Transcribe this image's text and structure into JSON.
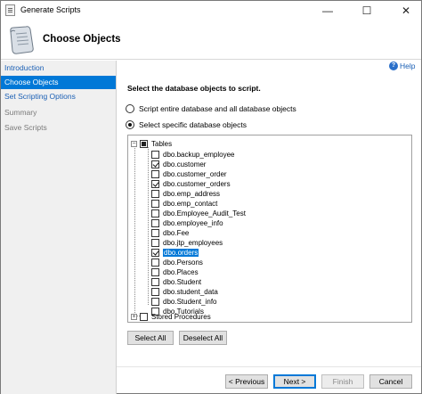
{
  "window": {
    "title": "Generate Scripts",
    "minimize_glyph": "—",
    "maximize_glyph": "☐",
    "close_glyph": "✕"
  },
  "header": {
    "title": "Choose Objects",
    "icon": "scroll-icon"
  },
  "nav": {
    "items": [
      {
        "label": "Introduction",
        "state": "link"
      },
      {
        "label": "Choose Objects",
        "state": "selected"
      },
      {
        "label": "Set Scripting Options",
        "state": "link"
      },
      {
        "label": "Summary",
        "state": "disabled"
      },
      {
        "label": "Save Scripts",
        "state": "disabled"
      }
    ]
  },
  "help": {
    "label": "Help",
    "icon": "help-icon"
  },
  "main": {
    "instruction": "Select the database objects to script.",
    "radio_entire": "Script entire database and all database objects",
    "radio_specific": "Select specific database objects",
    "selected_option": "specific"
  },
  "tree": {
    "tables_label": "Tables",
    "tables_state": "indeterminate",
    "tables_expander": "−",
    "items": [
      {
        "label": "dbo.backup_employee",
        "checked": false
      },
      {
        "label": "dbo.customer",
        "checked": true
      },
      {
        "label": "dbo.customer_order",
        "checked": false
      },
      {
        "label": "dbo.customer_orders",
        "checked": true
      },
      {
        "label": "dbo.emp_address",
        "checked": false
      },
      {
        "label": "dbo.emp_contact",
        "checked": false
      },
      {
        "label": "dbo.Employee_Audit_Test",
        "checked": false
      },
      {
        "label": "dbo.employee_info",
        "checked": false
      },
      {
        "label": "dbo.Fee",
        "checked": false
      },
      {
        "label": "dbo.jtp_employees",
        "checked": false
      },
      {
        "label": "dbo.orders",
        "checked": true,
        "highlighted": true
      },
      {
        "label": "dbo.Persons",
        "checked": false
      },
      {
        "label": "dbo.Places",
        "checked": false
      },
      {
        "label": "dbo.Student",
        "checked": false
      },
      {
        "label": "dbo.student_data",
        "checked": false
      },
      {
        "label": "dbo.Student_info",
        "checked": false
      },
      {
        "label": "dbo.Tutorials",
        "checked": false
      }
    ],
    "stored_procedures_label": "Stored Procedures",
    "stored_procedures_expander": "+"
  },
  "buttons": {
    "select_all": "Select All",
    "deselect_all": "Deselect All",
    "previous": "< Previous",
    "next": "Next >",
    "finish": "Finish",
    "cancel": "Cancel"
  },
  "colors": {
    "selection": "#0078d7",
    "link": "#1a5fb4"
  }
}
